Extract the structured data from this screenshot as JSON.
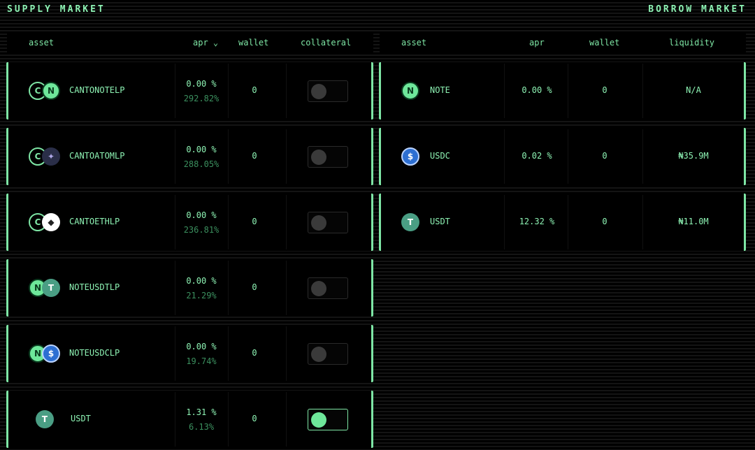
{
  "supply": {
    "title": "SUPPLY MARKET",
    "headers": {
      "asset": "asset",
      "apr": "apr ⌄",
      "wallet": "wallet",
      "collateral": "collateral"
    },
    "rows": [
      {
        "name": "CANTONOTELP",
        "apr": "0.00 %",
        "apr_sub": "292.82%",
        "wallet": "0",
        "collateral": false,
        "icons": [
          "canto",
          "note"
        ],
        "glyphs": [
          "C",
          "N"
        ]
      },
      {
        "name": "CANTOATOMLP",
        "apr": "0.00 %",
        "apr_sub": "288.05%",
        "wallet": "0",
        "collateral": false,
        "icons": [
          "canto",
          "atom"
        ],
        "glyphs": [
          "C",
          "✦"
        ]
      },
      {
        "name": "CANTOETHLP",
        "apr": "0.00 %",
        "apr_sub": "236.81%",
        "wallet": "0",
        "collateral": false,
        "icons": [
          "canto",
          "eth"
        ],
        "glyphs": [
          "C",
          "◆"
        ]
      },
      {
        "name": "NOTEUSDTLP",
        "apr": "0.00 %",
        "apr_sub": "21.29%",
        "wallet": "0",
        "collateral": false,
        "icons": [
          "note",
          "usdt"
        ],
        "glyphs": [
          "N",
          "T"
        ]
      },
      {
        "name": "NOTEUSDCLP",
        "apr": "0.00 %",
        "apr_sub": "19.74%",
        "wallet": "0",
        "collateral": false,
        "icons": [
          "note",
          "usdc"
        ],
        "glyphs": [
          "N",
          "$"
        ]
      },
      {
        "name": "USDT",
        "apr": "1.31 %",
        "apr_sub": "6.13%",
        "wallet": "0",
        "collateral": true,
        "icons": [
          "usdt"
        ],
        "glyphs": [
          "T"
        ]
      }
    ]
  },
  "borrow": {
    "title": "BORROW MARKET",
    "headers": {
      "asset": "asset",
      "apr": "apr",
      "wallet": "wallet",
      "liquidity": "liquidity"
    },
    "rows": [
      {
        "name": "NOTE",
        "apr": "0.00 %",
        "wallet": "0",
        "liquidity": "N/A",
        "icon": "note",
        "glyph": "N"
      },
      {
        "name": "USDC",
        "apr": "0.02 %",
        "wallet": "0",
        "liquidity": "₦35.9M",
        "icon": "usdc",
        "glyph": "$"
      },
      {
        "name": "USDT",
        "apr": "12.32 %",
        "wallet": "0",
        "liquidity": "₦11.0M",
        "icon": "usdt",
        "glyph": "T"
      }
    ]
  },
  "colors": {
    "accent": "#7ee6a5",
    "background": "#000000",
    "muted": "#3b8f5e"
  }
}
